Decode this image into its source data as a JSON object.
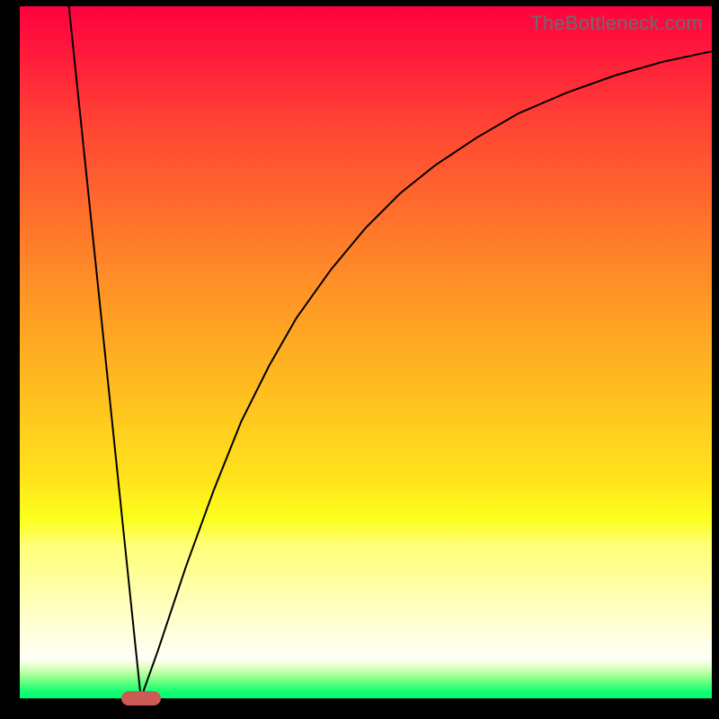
{
  "watermark": "TheBottleneck.com",
  "chart_data": {
    "type": "line",
    "title": "",
    "xlabel": "",
    "ylabel": "",
    "xlim": [
      0,
      100
    ],
    "ylim": [
      0,
      100
    ],
    "marker": {
      "x_center": 17.5,
      "width_pct": 5.7,
      "y": 0
    },
    "series": [
      {
        "name": "left-line",
        "x": [
          7.1,
          17.5
        ],
        "values": [
          100,
          0
        ]
      },
      {
        "name": "right-curve",
        "x": [
          17.5,
          20,
          24,
          28,
          32,
          36,
          40,
          45,
          50,
          55,
          60,
          66,
          72,
          79,
          86,
          93,
          100
        ],
        "values": [
          0,
          7,
          19,
          30,
          40,
          48,
          55,
          62,
          68,
          73,
          77,
          81,
          84.5,
          87.5,
          90,
          92,
          93.5
        ]
      }
    ],
    "colors": {
      "curve": "#000000",
      "marker": "#cc5a55",
      "gradient_top": "#ff0040",
      "gradient_bottom": "#00ff75"
    }
  }
}
